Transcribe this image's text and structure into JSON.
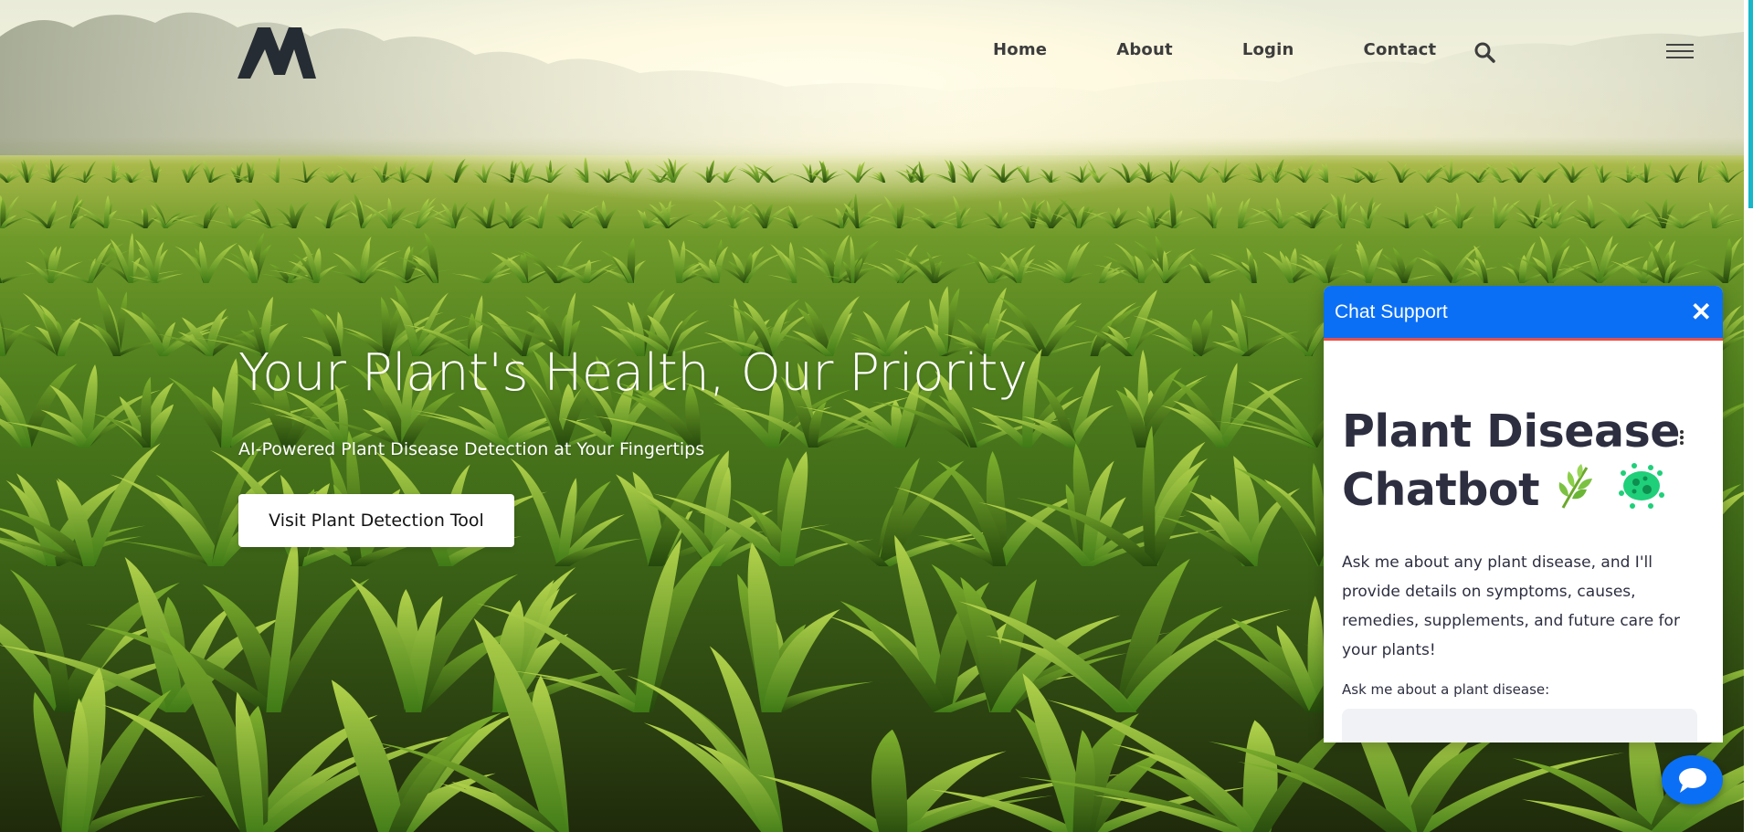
{
  "nav": {
    "links": [
      "Home",
      "About",
      "Login",
      "Contact"
    ]
  },
  "hero": {
    "title": "Your Plant's Health, Our Priority",
    "subtitle": "AI-Powered Plant Disease Detection at Your Fingertips",
    "cta_label": "Visit Plant Detection Tool"
  },
  "chat": {
    "header_title": "Chat Support",
    "close_glyph": "✕",
    "heading": "Plant Disease Chatbot",
    "description": "Ask me about any plant disease, and I'll provide details on symptoms, causes, remedies, supplements, and future care for your plants!",
    "input_label": "Ask me about a plant disease:",
    "input_value": ""
  },
  "icons": {
    "logo": "m-logo",
    "search": "search-icon",
    "menu": "hamburger-icon",
    "more": "kebab-icon",
    "herb_emoji": "herb-icon",
    "microbe_emoji": "microbe-icon",
    "chat_bubble": "chat-bubble-icon"
  },
  "colors": {
    "accent": "#0b6ff6",
    "header_underline": "#e8504a",
    "heading_text": "#2d2f40",
    "input_bg": "#f0f2f6"
  }
}
